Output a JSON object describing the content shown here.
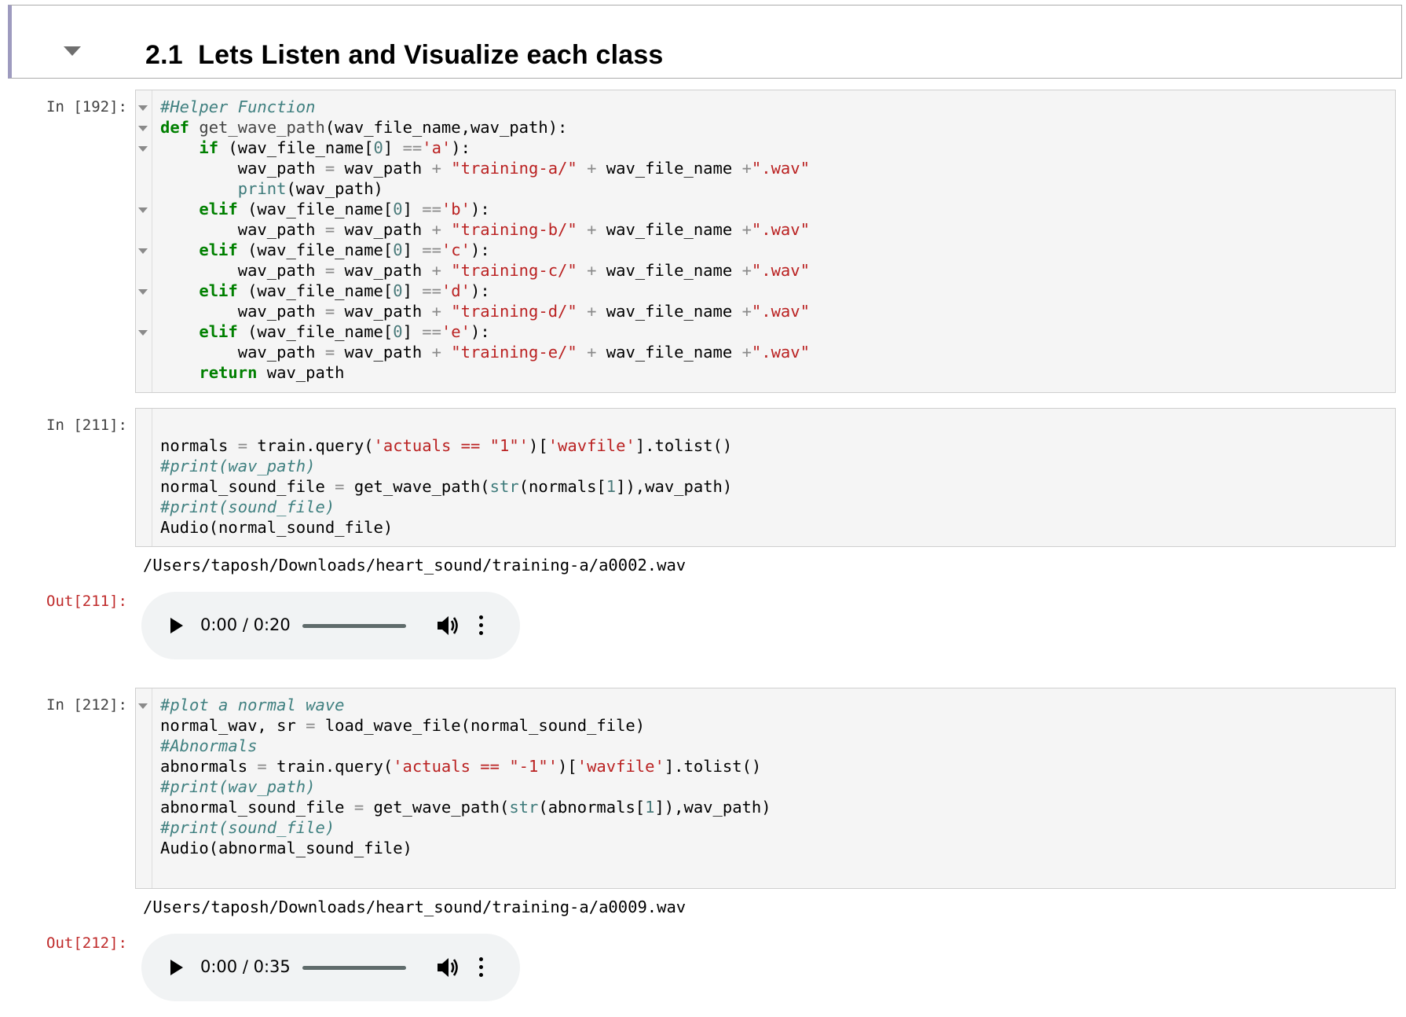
{
  "header": {
    "title": "2.1  Lets Listen and Visualize each class"
  },
  "cells": [
    {
      "prompt": "In [192]:",
      "lines": [
        [
          {
            "t": "#Helper Function",
            "c": "comment"
          }
        ],
        [
          {
            "t": "def",
            "c": "kw"
          },
          {
            "t": " get_wave_path",
            "c": "defname"
          },
          {
            "t": "(wav_file_name,wav_path):",
            "c": ""
          }
        ],
        [
          {
            "t": "    ",
            "c": ""
          },
          {
            "t": "if",
            "c": "kw"
          },
          {
            "t": " (wav_file_name[",
            "c": ""
          },
          {
            "t": "0",
            "c": "num"
          },
          {
            "t": "] ",
            "c": ""
          },
          {
            "t": "==",
            "c": "op"
          },
          {
            "t": "'a'",
            "c": "str"
          },
          {
            "t": "):",
            "c": ""
          }
        ],
        [
          {
            "t": "        wav_path ",
            "c": ""
          },
          {
            "t": "=",
            "c": "op"
          },
          {
            "t": " wav_path ",
            "c": ""
          },
          {
            "t": "+",
            "c": "op"
          },
          {
            "t": " ",
            "c": ""
          },
          {
            "t": "\"training-a/\"",
            "c": "str"
          },
          {
            "t": " ",
            "c": ""
          },
          {
            "t": "+",
            "c": "op"
          },
          {
            "t": " wav_file_name ",
            "c": ""
          },
          {
            "t": "+",
            "c": "op"
          },
          {
            "t": "\".wav\"",
            "c": "str"
          }
        ],
        [
          {
            "t": "        ",
            "c": ""
          },
          {
            "t": "print",
            "c": "builtin"
          },
          {
            "t": "(wav_path)",
            "c": ""
          }
        ],
        [
          {
            "t": "    ",
            "c": ""
          },
          {
            "t": "elif",
            "c": "kw"
          },
          {
            "t": " (wav_file_name[",
            "c": ""
          },
          {
            "t": "0",
            "c": "num"
          },
          {
            "t": "] ",
            "c": ""
          },
          {
            "t": "==",
            "c": "op"
          },
          {
            "t": "'b'",
            "c": "str"
          },
          {
            "t": "):",
            "c": ""
          }
        ],
        [
          {
            "t": "        wav_path ",
            "c": ""
          },
          {
            "t": "=",
            "c": "op"
          },
          {
            "t": " wav_path ",
            "c": ""
          },
          {
            "t": "+",
            "c": "op"
          },
          {
            "t": " ",
            "c": ""
          },
          {
            "t": "\"training-b/\"",
            "c": "str"
          },
          {
            "t": " ",
            "c": ""
          },
          {
            "t": "+",
            "c": "op"
          },
          {
            "t": " wav_file_name ",
            "c": ""
          },
          {
            "t": "+",
            "c": "op"
          },
          {
            "t": "\".wav\"",
            "c": "str"
          }
        ],
        [
          {
            "t": "    ",
            "c": ""
          },
          {
            "t": "elif",
            "c": "kw"
          },
          {
            "t": " (wav_file_name[",
            "c": ""
          },
          {
            "t": "0",
            "c": "num"
          },
          {
            "t": "] ",
            "c": ""
          },
          {
            "t": "==",
            "c": "op"
          },
          {
            "t": "'c'",
            "c": "str"
          },
          {
            "t": "):",
            "c": ""
          }
        ],
        [
          {
            "t": "        wav_path ",
            "c": ""
          },
          {
            "t": "=",
            "c": "op"
          },
          {
            "t": " wav_path ",
            "c": ""
          },
          {
            "t": "+",
            "c": "op"
          },
          {
            "t": " ",
            "c": ""
          },
          {
            "t": "\"training-c/\"",
            "c": "str"
          },
          {
            "t": " ",
            "c": ""
          },
          {
            "t": "+",
            "c": "op"
          },
          {
            "t": " wav_file_name ",
            "c": ""
          },
          {
            "t": "+",
            "c": "op"
          },
          {
            "t": "\".wav\"",
            "c": "str"
          }
        ],
        [
          {
            "t": "    ",
            "c": ""
          },
          {
            "t": "elif",
            "c": "kw"
          },
          {
            "t": " (wav_file_name[",
            "c": ""
          },
          {
            "t": "0",
            "c": "num"
          },
          {
            "t": "] ",
            "c": ""
          },
          {
            "t": "==",
            "c": "op"
          },
          {
            "t": "'d'",
            "c": "str"
          },
          {
            "t": "):",
            "c": ""
          }
        ],
        [
          {
            "t": "        wav_path ",
            "c": ""
          },
          {
            "t": "=",
            "c": "op"
          },
          {
            "t": " wav_path ",
            "c": ""
          },
          {
            "t": "+",
            "c": "op"
          },
          {
            "t": " ",
            "c": ""
          },
          {
            "t": "\"training-d/\"",
            "c": "str"
          },
          {
            "t": " ",
            "c": ""
          },
          {
            "t": "+",
            "c": "op"
          },
          {
            "t": " wav_file_name ",
            "c": ""
          },
          {
            "t": "+",
            "c": "op"
          },
          {
            "t": "\".wav\"",
            "c": "str"
          }
        ],
        [
          {
            "t": "    ",
            "c": ""
          },
          {
            "t": "elif",
            "c": "kw"
          },
          {
            "t": " (wav_file_name[",
            "c": ""
          },
          {
            "t": "0",
            "c": "num"
          },
          {
            "t": "] ",
            "c": ""
          },
          {
            "t": "==",
            "c": "op"
          },
          {
            "t": "'e'",
            "c": "str"
          },
          {
            "t": "):",
            "c": ""
          }
        ],
        [
          {
            "t": "        wav_path ",
            "c": ""
          },
          {
            "t": "=",
            "c": "op"
          },
          {
            "t": " wav_path ",
            "c": ""
          },
          {
            "t": "+",
            "c": "op"
          },
          {
            "t": " ",
            "c": ""
          },
          {
            "t": "\"training-e/\"",
            "c": "str"
          },
          {
            "t": " ",
            "c": ""
          },
          {
            "t": "+",
            "c": "op"
          },
          {
            "t": " wav_file_name ",
            "c": ""
          },
          {
            "t": "+",
            "c": "op"
          },
          {
            "t": "\".wav\"",
            "c": "str"
          }
        ],
        [
          {
            "t": "    ",
            "c": ""
          },
          {
            "t": "return",
            "c": "kw"
          },
          {
            "t": " wav_path",
            "c": ""
          }
        ]
      ]
    },
    {
      "prompt": "In [211]:",
      "lines": [
        [
          {
            "t": "",
            "c": ""
          }
        ],
        [
          {
            "t": "normals ",
            "c": ""
          },
          {
            "t": "=",
            "c": "op"
          },
          {
            "t": " train.query(",
            "c": ""
          },
          {
            "t": "'actuals == \"1\"'",
            "c": "str"
          },
          {
            "t": ")[",
            "c": ""
          },
          {
            "t": "'wavfile'",
            "c": "str"
          },
          {
            "t": "].tolist()",
            "c": ""
          }
        ],
        [
          {
            "t": "#print(wav_path)",
            "c": "comment"
          }
        ],
        [
          {
            "t": "normal_sound_file ",
            "c": ""
          },
          {
            "t": "=",
            "c": "op"
          },
          {
            "t": " get_wave_path(",
            "c": ""
          },
          {
            "t": "str",
            "c": "builtin"
          },
          {
            "t": "(normals[",
            "c": ""
          },
          {
            "t": "1",
            "c": "num"
          },
          {
            "t": "]),wav_path)",
            "c": ""
          }
        ],
        [
          {
            "t": "#print(sound_file)",
            "c": "comment"
          }
        ],
        [
          {
            "t": "Audio(normal_sound_file)",
            "c": ""
          }
        ]
      ],
      "stdout": "/Users/taposh/Downloads/heart_sound/training-a/a0002.wav",
      "out_prompt": "Out[211]:",
      "audio": {
        "time": "0:00 / 0:20",
        "progress": 0
      }
    },
    {
      "prompt": "In [212]:",
      "lines": [
        [
          {
            "t": "#plot a normal wave",
            "c": "comment"
          }
        ],
        [
          {
            "t": "normal_wav, sr ",
            "c": ""
          },
          {
            "t": "=",
            "c": "op"
          },
          {
            "t": " load_wave_file(normal_sound_file)",
            "c": ""
          }
        ],
        [
          {
            "t": "#Abnormals",
            "c": "comment"
          }
        ],
        [
          {
            "t": "abnormals ",
            "c": ""
          },
          {
            "t": "=",
            "c": "op"
          },
          {
            "t": " train.query(",
            "c": ""
          },
          {
            "t": "'actuals == \"-1\"'",
            "c": "str"
          },
          {
            "t": ")[",
            "c": ""
          },
          {
            "t": "'wavfile'",
            "c": "str"
          },
          {
            "t": "].tolist()",
            "c": ""
          }
        ],
        [
          {
            "t": "#print(wav_path)",
            "c": "comment"
          }
        ],
        [
          {
            "t": "abnormal_sound_file ",
            "c": ""
          },
          {
            "t": "=",
            "c": "op"
          },
          {
            "t": " get_wave_path(",
            "c": ""
          },
          {
            "t": "str",
            "c": "builtin"
          },
          {
            "t": "(abnormals[",
            "c": ""
          },
          {
            "t": "1",
            "c": "num"
          },
          {
            "t": "]),wav_path)",
            "c": ""
          }
        ],
        [
          {
            "t": "#print(sound_file)",
            "c": "comment"
          }
        ],
        [
          {
            "t": "Audio(abnormal_sound_file)",
            "c": ""
          }
        ]
      ],
      "stdout": "/Users/taposh/Downloads/heart_sound/training-a/a0009.wav",
      "out_prompt": "Out[212]:",
      "audio": {
        "time": "0:00 / 0:35",
        "progress": 0
      }
    }
  ],
  "icons": {
    "collapse": "caret-down-icon",
    "fold": "fold-arrow-icon",
    "play": "play-icon",
    "volume": "volume-icon",
    "more": "more-vertical-icon"
  },
  "colors": {
    "comment": "#408080",
    "keyword": "#008000",
    "string": "#ba2121",
    "out_prompt": "#bf2a2a",
    "cell_bg": "#f5f5f5",
    "header_accent": "#9e9bbf"
  }
}
